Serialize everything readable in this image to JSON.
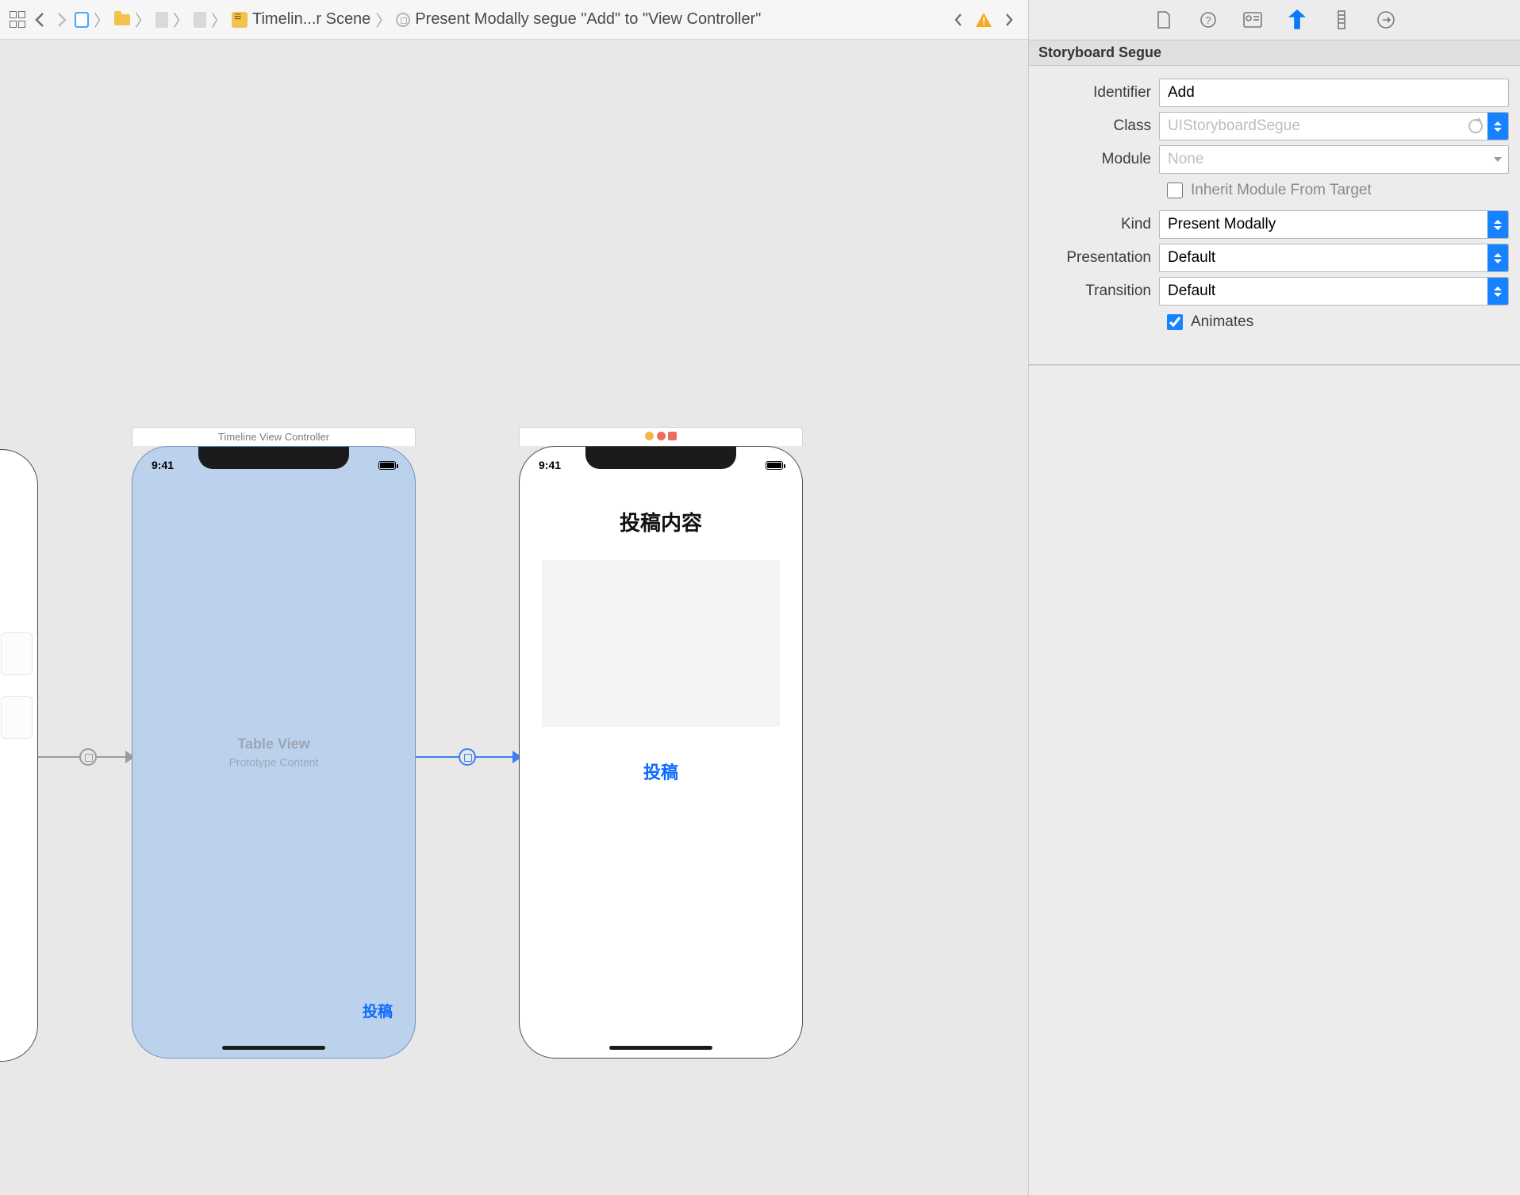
{
  "jumpbar": {
    "scene": "Timelin...r Scene",
    "segue": "Present Modally segue \"Add\" to \"View Controller\""
  },
  "canvas": {
    "scene1_title": "Timeline View Controller",
    "time": "9:41",
    "table_view": "Table View",
    "prototype_content": "Prototype Content",
    "tab_post": "投稿",
    "post_title": "投稿内容",
    "post_button": "投稿"
  },
  "inspector": {
    "header": "Storyboard Segue",
    "labels": {
      "identifier": "Identifier",
      "class": "Class",
      "module": "Module",
      "inherit": "Inherit Module From Target",
      "kind": "Kind",
      "presentation": "Presentation",
      "transition": "Transition",
      "animates": "Animates"
    },
    "values": {
      "identifier": "Add",
      "class_placeholder": "UIStoryboardSegue",
      "module_placeholder": "None",
      "kind": "Present Modally",
      "presentation": "Default",
      "transition": "Default"
    },
    "inherit_checked": false,
    "animates_checked": true
  }
}
